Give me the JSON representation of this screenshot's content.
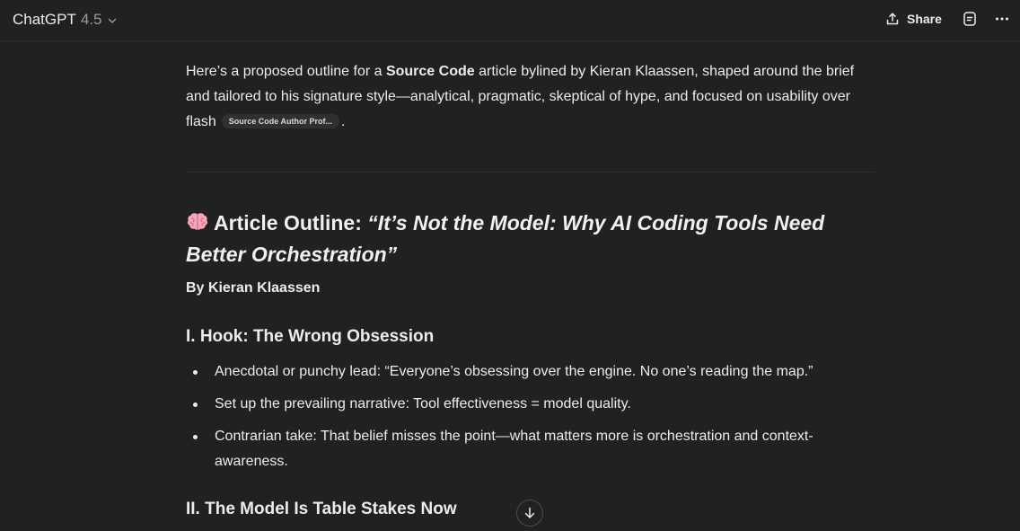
{
  "header": {
    "model_name": "ChatGPT",
    "model_version": "4.5",
    "share_label": "Share"
  },
  "message": {
    "intro_part1": "Here’s a proposed outline for a ",
    "intro_bold": "Source Code",
    "intro_part2": " article bylined by Kieran Klaassen, shaped around the brief and tailored to his signature style—analytical, pragmatic, skeptical of hype, and focused on usability over flash",
    "citation_chip": "Source Code Author Prof...",
    "intro_end": ".",
    "title_prefix": "Article Outline: ",
    "title_italic": "“It’s Not the Model: Why AI Coding Tools Need Better Orchestration”",
    "byline": "By Kieran Klaassen",
    "sections": [
      {
        "heading": "I. Hook: The Wrong Obsession",
        "bullets": [
          "Anecdotal or punchy lead: “Everyone’s obsessing over the engine. No one’s reading the map.”",
          "Set up the prevailing narrative: Tool effectiveness = model quality.",
          "Contrarian take: That belief misses the point—what matters more is orchestration and context-awareness."
        ]
      },
      {
        "heading": "II. The Model Is Table Stakes Now"
      }
    ]
  },
  "icons": {
    "title_emoji": "brain-icon",
    "share": "share-icon",
    "doc": "document-icon",
    "more": "more-icon",
    "scroll": "arrow-down-icon"
  },
  "colors": {
    "background": "#212121",
    "text": "#ececec",
    "muted": "#9b9b9b",
    "chip_bg": "#303030"
  }
}
